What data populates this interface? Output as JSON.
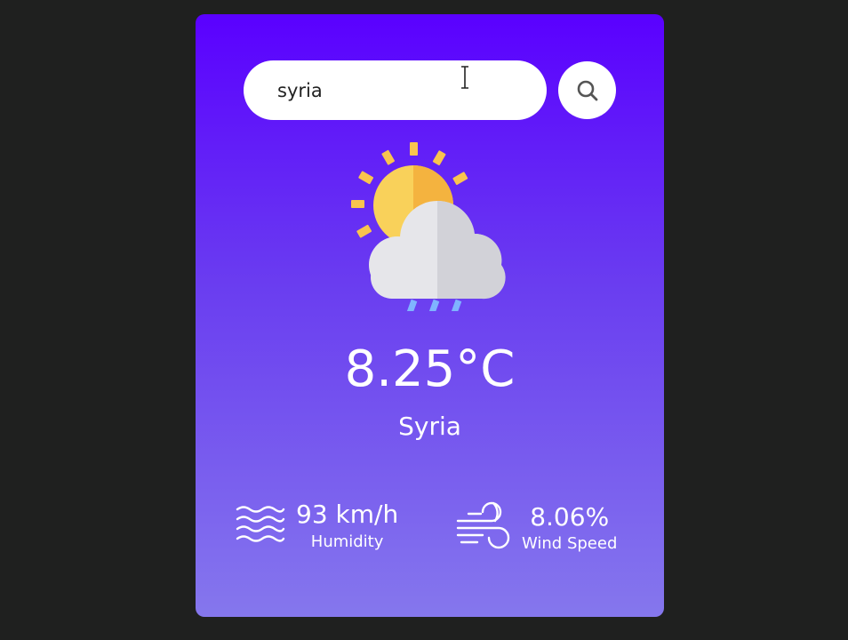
{
  "search": {
    "value": "syria"
  },
  "weather": {
    "temperature": "8.25°C",
    "city": "Syria",
    "condition_icon": "sun-cloud-rain-icon"
  },
  "stats": {
    "humidity": {
      "value": "93 km/h",
      "label": "Humidity",
      "icon": "waves-icon"
    },
    "wind": {
      "value": "8.06%",
      "label": "Wind Speed",
      "icon": "wind-icon"
    }
  },
  "colors": {
    "background": "#1f201f",
    "card_gradient_top": "#5a00ff",
    "card_gradient_bottom": "#8577ed",
    "sun": "#f9c44e",
    "cloud_light": "#e6e6ea",
    "cloud_shade": "#d2d2d8",
    "rain": "#7fb4ff"
  }
}
